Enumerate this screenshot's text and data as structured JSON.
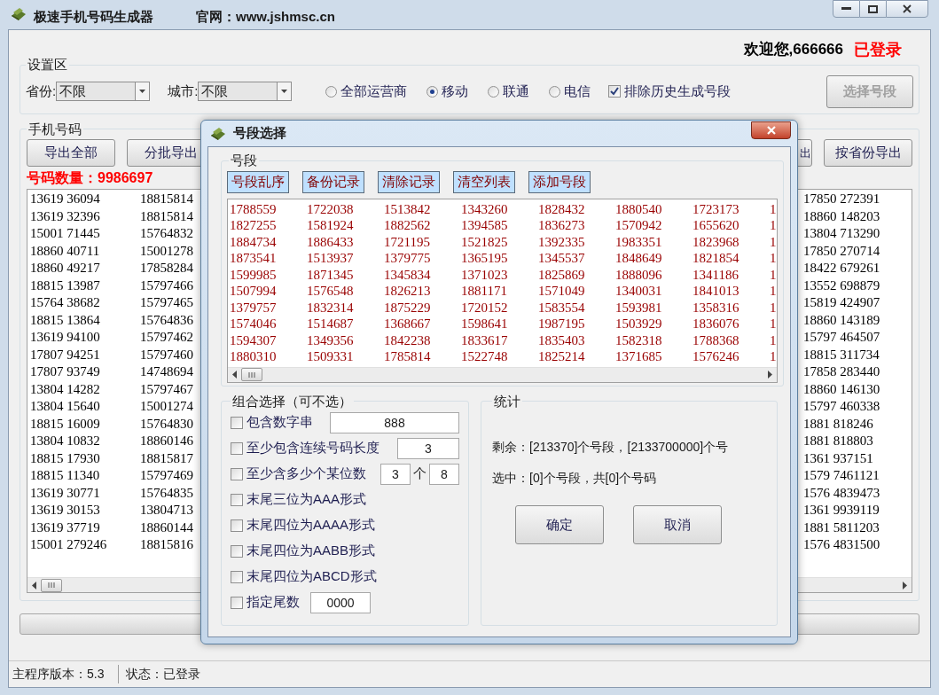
{
  "window": {
    "title": "极速手机号码生成器",
    "site": "官网：www.jshmsc.cn"
  },
  "welcome": {
    "text": "欢迎您,666666",
    "status": "已登录"
  },
  "settings": {
    "legend": "设置区",
    "province_label": "省份:",
    "province_value": "不限",
    "city_label": "城市:",
    "city_value": "不限",
    "carriers": [
      {
        "label": "全部运营商",
        "selected": false
      },
      {
        "label": "移动",
        "selected": true
      },
      {
        "label": "联通",
        "selected": false
      },
      {
        "label": "电信",
        "selected": false
      }
    ],
    "exclude": {
      "label": "排除历史生成号段",
      "checked": true
    },
    "select_button": {
      "label": "选择号段",
      "disabled": true
    }
  },
  "phones": {
    "legend": "手机号码",
    "left_buttons": [
      "导出全部",
      "分批导出"
    ],
    "right_buttons": [
      "出",
      "按省份导出"
    ],
    "count": "号码数量：9986697",
    "left_column_1": [
      "13619 36094",
      "13619 32396",
      "15001 71445",
      "18860 40711",
      "18860 49217",
      "18815 13987",
      "15764 38682",
      "18815 13864",
      "13619 94100",
      "17807 94251",
      "17807 93749",
      "13804 14282",
      "13804 15640",
      "18815 16009",
      "13804 10832",
      "18815 17930",
      "18815 11340",
      "13619 30771",
      "13619 30153",
      "13619 37719",
      "15001 279246"
    ],
    "left_column_2": [
      "18815814",
      "18815814",
      "15764832",
      "15001278",
      "17858284",
      "15797466",
      "15797465",
      "15764836",
      "15797462",
      "15797460",
      "14748694",
      "15797467",
      "15001274",
      "15764830",
      "18860146",
      "18815817",
      "15797469",
      "15764835",
      "13804713",
      "18860144",
      "18815816"
    ],
    "right_column": [
      "17850 272391",
      "18860 148203",
      "13804 713290",
      "17850 270714",
      "18422 679261",
      "13552 698879",
      "15819 424907",
      "18860 143189",
      "15797 464507",
      "18815 311734",
      "17858 283440",
      "18860 146130",
      "15797 460338",
      "1881 818246",
      "1881 818803",
      "1361 937151",
      "1579 7461121",
      "1576 4839473",
      "1361 9939119",
      "1881 5811203",
      "1576 4831500"
    ]
  },
  "progress": {
    "level": 0
  },
  "status_bar": [
    "主程序版本：5.3",
    "状态：已登录"
  ],
  "dialog": {
    "title": "号段选择",
    "group": "号段",
    "buttons": [
      "号段乱序",
      "备份记录",
      "清除记录",
      "清空列表",
      "添加号段"
    ],
    "rows": [
      [
        "1788559",
        "1722038",
        "1513842",
        "1343260",
        "1828432",
        "1880540",
        "1723173",
        "1"
      ],
      [
        "1827255",
        "1581924",
        "1882562",
        "1394585",
        "1836273",
        "1570942",
        "1655620",
        "1"
      ],
      [
        "1884734",
        "1886433",
        "1721195",
        "1521825",
        "1392335",
        "1983351",
        "1823968",
        "1"
      ],
      [
        "1873541",
        "1513937",
        "1379775",
        "1365195",
        "1345537",
        "1848649",
        "1821854",
        "1"
      ],
      [
        "1599985",
        "1871345",
        "1345834",
        "1371023",
        "1825869",
        "1888096",
        "1341186",
        "1"
      ],
      [
        "1507994",
        "1576548",
        "1826213",
        "1881171",
        "1571049",
        "1340031",
        "1841013",
        "1"
      ],
      [
        "1379757",
        "1832314",
        "1875229",
        "1720152",
        "1583554",
        "1593981",
        "1358316",
        "1"
      ],
      [
        "1574046",
        "1514687",
        "1368667",
        "1598641",
        "1987195",
        "1503929",
        "1836076",
        "1"
      ],
      [
        "1594307",
        "1349356",
        "1842238",
        "1833617",
        "1835403",
        "1582318",
        "1788368",
        "1"
      ],
      [
        "1880310",
        "1509331",
        "1785814",
        "1522748",
        "1825214",
        "1371685",
        "1576246",
        "1"
      ]
    ],
    "combo_legend": "组合选择（可不选）",
    "options": [
      {
        "kind": "wide",
        "label": "包含数字串",
        "checked": false,
        "value": "888"
      },
      {
        "kind": "field",
        "label": "至少包含连续号码长度",
        "checked": false,
        "value": "3"
      },
      {
        "kind": "pair",
        "label": "至少含多少个某位数",
        "checked": false,
        "value": "3",
        "unit": "个",
        "value2": "8"
      },
      {
        "kind": "plain",
        "label": "末尾三位为AAA形式",
        "checked": false
      },
      {
        "kind": "plain",
        "label": "末尾四位为AAAA形式",
        "checked": false
      },
      {
        "kind": "plain",
        "label": "末尾四位为AABB形式",
        "checked": false
      },
      {
        "kind": "plain",
        "label": "末尾四位为ABCD形式",
        "checked": false
      },
      {
        "kind": "short",
        "label": "指定尾数",
        "checked": false,
        "value": "0000"
      }
    ],
    "stats_legend": "统计",
    "stats": [
      "剩余：[213370]个号段，[2133700000]个号",
      "选中：[0]个号段，共[0]个号码"
    ],
    "actions": [
      "确定",
      "取消"
    ]
  }
}
